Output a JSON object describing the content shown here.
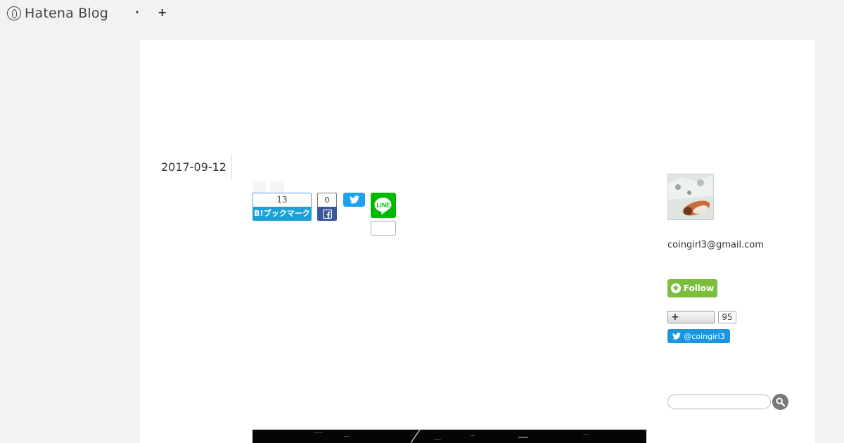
{
  "header": {
    "logo_text": "Hatena Blog",
    "logo_icon": "hatena-logo-icon",
    "menu_caret_glyph": "▾",
    "add_glyph": "+"
  },
  "entry": {
    "date": "2017-09-12",
    "share": {
      "hatena_bookmark_count": "13",
      "hatena_bookmark_label": "B!ブックマーク",
      "facebook_count": "0",
      "facebook_icon": "facebook-icon",
      "twitter_icon": "twitter-icon",
      "line_label": "LINE",
      "line_count": ""
    }
  },
  "sidebar": {
    "email": "coingirl3@gmail.com",
    "follow_label": "Follow",
    "reader_add_glyph": "+",
    "reader_count": "95",
    "twitter_follow_label": "@coingirl3",
    "search_placeholder": ""
  },
  "colors": {
    "hatena_blue": "#1da0d6",
    "facebook_blue": "#3b5998",
    "twitter_blue": "#1da1f2",
    "line_green": "#00b900",
    "feedly_green": "#7cbd3d"
  }
}
